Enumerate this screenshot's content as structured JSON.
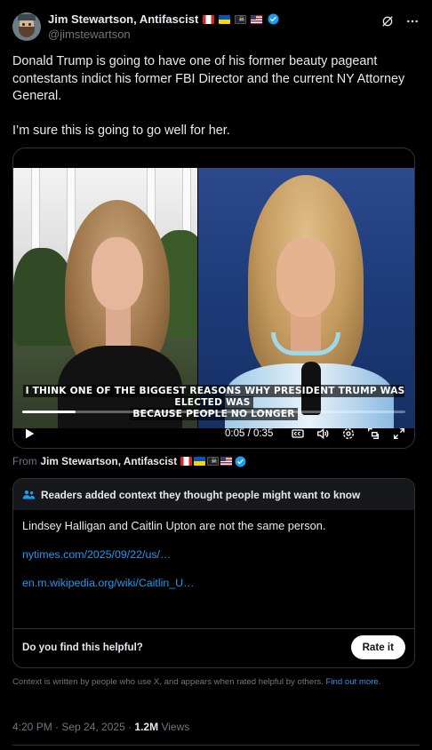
{
  "author": {
    "display_name": "Jim Stewartson, Antifascist",
    "handle": "@jimstewartson"
  },
  "tweet": {
    "paragraphs": [
      "Donald Trump is going to have one of his former beauty pageant contestants indict his former FBI Director and the current NY Attorney General.",
      "I’m sure this is going to go well for her."
    ]
  },
  "video": {
    "subtitle_line1": "I think one of the biggest reasons why President Trump was elected was",
    "subtitle_line2": "because people no longer",
    "time": "0:05 / 0:35",
    "progress": 0.14
  },
  "from": {
    "prefix": "From",
    "name": "Jim Stewartson, Antifascist"
  },
  "note": {
    "header": "Readers added context they thought people might want to know",
    "text": "Lindsey Halligan and Caitlin Upton are not the same person.",
    "links": [
      "nytimes.com/2025/09/22/us/…",
      "en.m.wikipedia.org/wiki/Caitlin_U…"
    ],
    "helpful_prompt": "Do you find this helpful?",
    "rate_button": "Rate it"
  },
  "context_note": {
    "text": "Context is written by people who use X, and appears when rated helpful by others.",
    "link": "Find out more."
  },
  "meta": {
    "timestamp": "4:20 PM · Sep 24, 2025 · ",
    "views_count": "1.2M",
    "views_label": " Views"
  },
  "colors": {
    "accent": "#1d9bf0",
    "background": "#000000",
    "border": "#2f3336",
    "muted": "#71767b"
  },
  "icons": [
    "grok-icon",
    "more-icon",
    "verified-icon",
    "play-icon",
    "captions-icon",
    "volume-icon",
    "settings-icon",
    "pip-icon",
    "fullscreen-icon",
    "people-icon"
  ]
}
